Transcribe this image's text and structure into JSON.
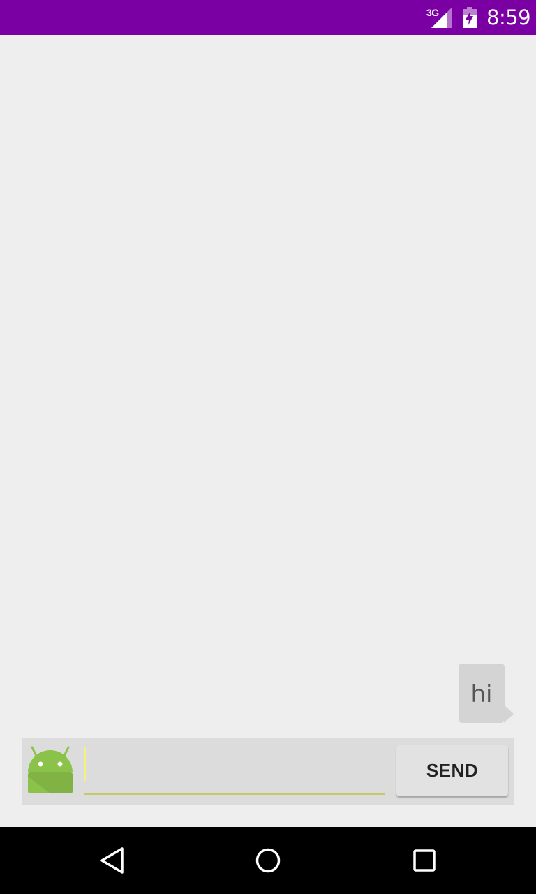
{
  "status_bar": {
    "network": "3G",
    "time": "8:59",
    "signal_icon": "signal-icon",
    "battery_icon": "battery-charging-icon",
    "background_color": "#7B00A3"
  },
  "chat": {
    "messages": [
      {
        "text": "hi",
        "side": "right"
      }
    ]
  },
  "input_bar": {
    "avatar_icon": "android-robot-icon",
    "message_value": "",
    "send_label": "SEND"
  },
  "nav_bar": {
    "back_icon": "back-triangle-icon",
    "home_icon": "home-circle-icon",
    "recents_icon": "recents-square-icon"
  }
}
